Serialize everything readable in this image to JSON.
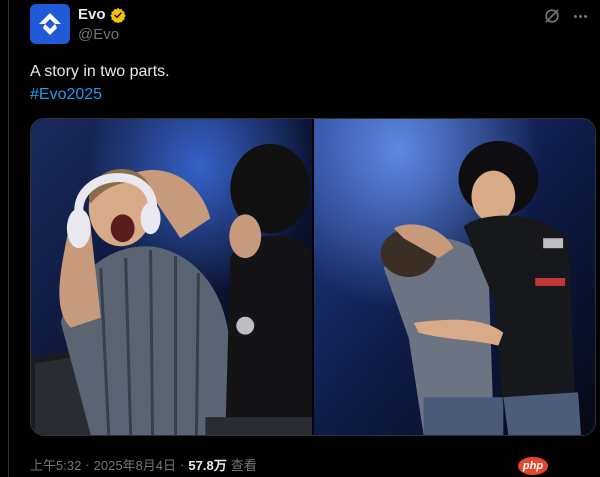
{
  "account": {
    "name": "Evo",
    "handle": "@Evo"
  },
  "tweet": {
    "text": "A story in two parts.",
    "hashtag": "#Evo2025"
  },
  "media": {
    "photos": [
      {
        "description_icon": "photo-player-celebrating"
      },
      {
        "description_icon": "photo-player-laughing"
      }
    ]
  },
  "meta": {
    "time": "上午5:32",
    "separator1": "·",
    "date": "2025年8月4日",
    "separator2": "·",
    "views_count": "57.8万",
    "views_label": "查看"
  },
  "watermark": {
    "text": "php"
  },
  "colors": {
    "background": "#000000",
    "text": "#e7e9ea",
    "muted": "#71767b",
    "link": "#1d9bf0",
    "verified": "#f4c20d",
    "avatar": "#1f5bd8"
  }
}
